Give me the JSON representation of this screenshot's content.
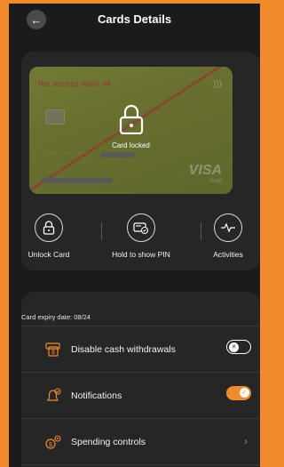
{
  "header": {
    "title": "Cards Details",
    "back_icon": "arrow-left-icon"
  },
  "card": {
    "bank_name": "the access bank uk",
    "brand": "VISA",
    "brand_sub": "Debit",
    "masked_number": "···· ···· ····",
    "lock_label": "Card locked",
    "card_color": "#8a9432"
  },
  "actions": [
    {
      "label": "Unlock Card",
      "icon": "padlock-icon"
    },
    {
      "label": "Hold to show PIN",
      "icon": "card-pin-icon"
    },
    {
      "label": "Activities",
      "icon": "pulse-icon"
    }
  ],
  "settings": {
    "expiry": "Card expiry date: 08/24",
    "rows": [
      {
        "label": "Disable cash withdrawals",
        "icon": "cash-icon",
        "control": "toggle",
        "on": false
      },
      {
        "label": "Notifications",
        "icon": "bell-icon",
        "control": "toggle",
        "on": true
      },
      {
        "label": "Spending controls",
        "icon": "spending-controls-icon",
        "control": "chevron"
      }
    ]
  },
  "colors": {
    "accent": "#f08a2c",
    "background": "#1b1b1b",
    "panel": "#262626"
  }
}
